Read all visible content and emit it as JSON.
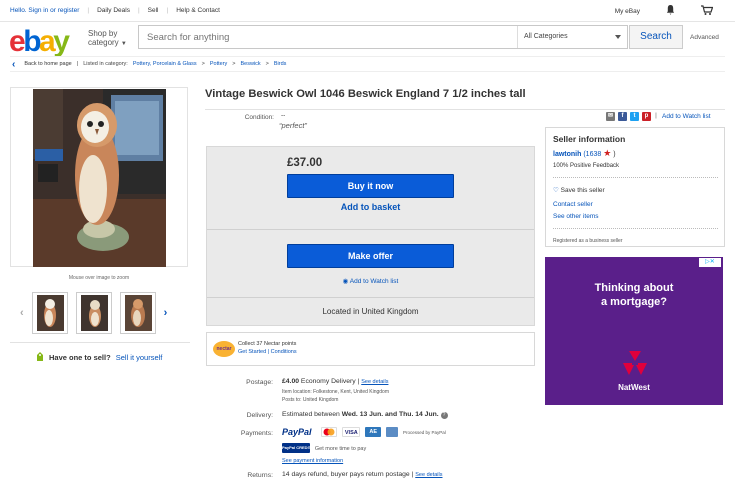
{
  "topbar": {
    "greeting": "Hello. Sign in or register",
    "daily_deals": "Daily Deals",
    "sell": "Sell",
    "help": "Help & Contact",
    "my_ebay": "My eBay"
  },
  "header": {
    "logo_letters": [
      "e",
      "b",
      "a",
      "y"
    ],
    "shop_by_line1": "Shop by",
    "shop_by_line2": "category",
    "search_placeholder": "Search for anything",
    "category_select": "All Categories",
    "search_button": "Search",
    "advanced": "Advanced"
  },
  "breadcrumb": {
    "back": "Back to home page",
    "listed_in": "Listed in category:",
    "items": [
      "Pottery, Porcelain & Glass",
      "Pottery",
      "Beswick",
      "Birds"
    ]
  },
  "gallery": {
    "mouse_over": "Mouse over image to zoom",
    "thumb_count": 3,
    "have_one": "Have one to sell?",
    "sell_it": "Sell it yourself"
  },
  "listing": {
    "title": "Vintage Beswick Owl 1046 Beswick England 7 1/2 inches tall",
    "condition_label": "Condition:",
    "condition_value": "--",
    "condition_quote": "“perfect”",
    "add_watch_list": "Add to Watch list",
    "price": "£37.00",
    "buy_now": "Buy it now",
    "add_basket": "Add to basket",
    "make_offer": "Make offer",
    "add_watch_list_2": "Add to Watch list",
    "located": "Located in United Kingdom"
  },
  "nectar": {
    "badge": "nectar",
    "line1": "Collect 37 Nectar points",
    "line2": "Get Started | Conditions"
  },
  "details": {
    "postage_label": "Postage:",
    "postage_value": "£4.00",
    "postage_method": "Economy Delivery |",
    "see_details": "See details",
    "item_location": "Item location:  Folkestone, Kent, United Kingdom",
    "posts_to": "Posts to:  United Kingdom",
    "delivery_label": "Delivery:",
    "delivery_value": "Estimated between",
    "delivery_dates": "Wed. 13 Jun. and Thu. 14 Jun.",
    "payments_label": "Payments:",
    "paypal": "PayPal",
    "visa": "VISA",
    "processed": "Processed by PayPal",
    "paypal_credit": "PayPal CREDIT",
    "more_time": "Get more time to pay",
    "see_payment": "See payment information",
    "returns_label": "Returns:",
    "returns_value": "14 days refund, buyer pays return postage |",
    "returns_details": "See details"
  },
  "seller": {
    "heading": "Seller information",
    "name": "lawtonih",
    "feedback_count": "(1638",
    "feedback_close": ")",
    "positive": "100% Positive Feedback",
    "save": "Save this seller",
    "contact": "Contact seller",
    "other": "See other items",
    "registered": "Registered as a business seller"
  },
  "ad": {
    "line1": "Thinking about",
    "line2": "a mortgage?",
    "brand": "NatWest",
    "adchoices": "▷✕"
  },
  "colors": {
    "ebay_red": "#e53238",
    "ebay_blue": "#0064d2",
    "ebay_yellow": "#f5af02",
    "ebay_green": "#86b817",
    "button_blue": "#0a5cd8",
    "link_blue": "#0654ba",
    "natwest_purple": "#5a1f8a"
  }
}
